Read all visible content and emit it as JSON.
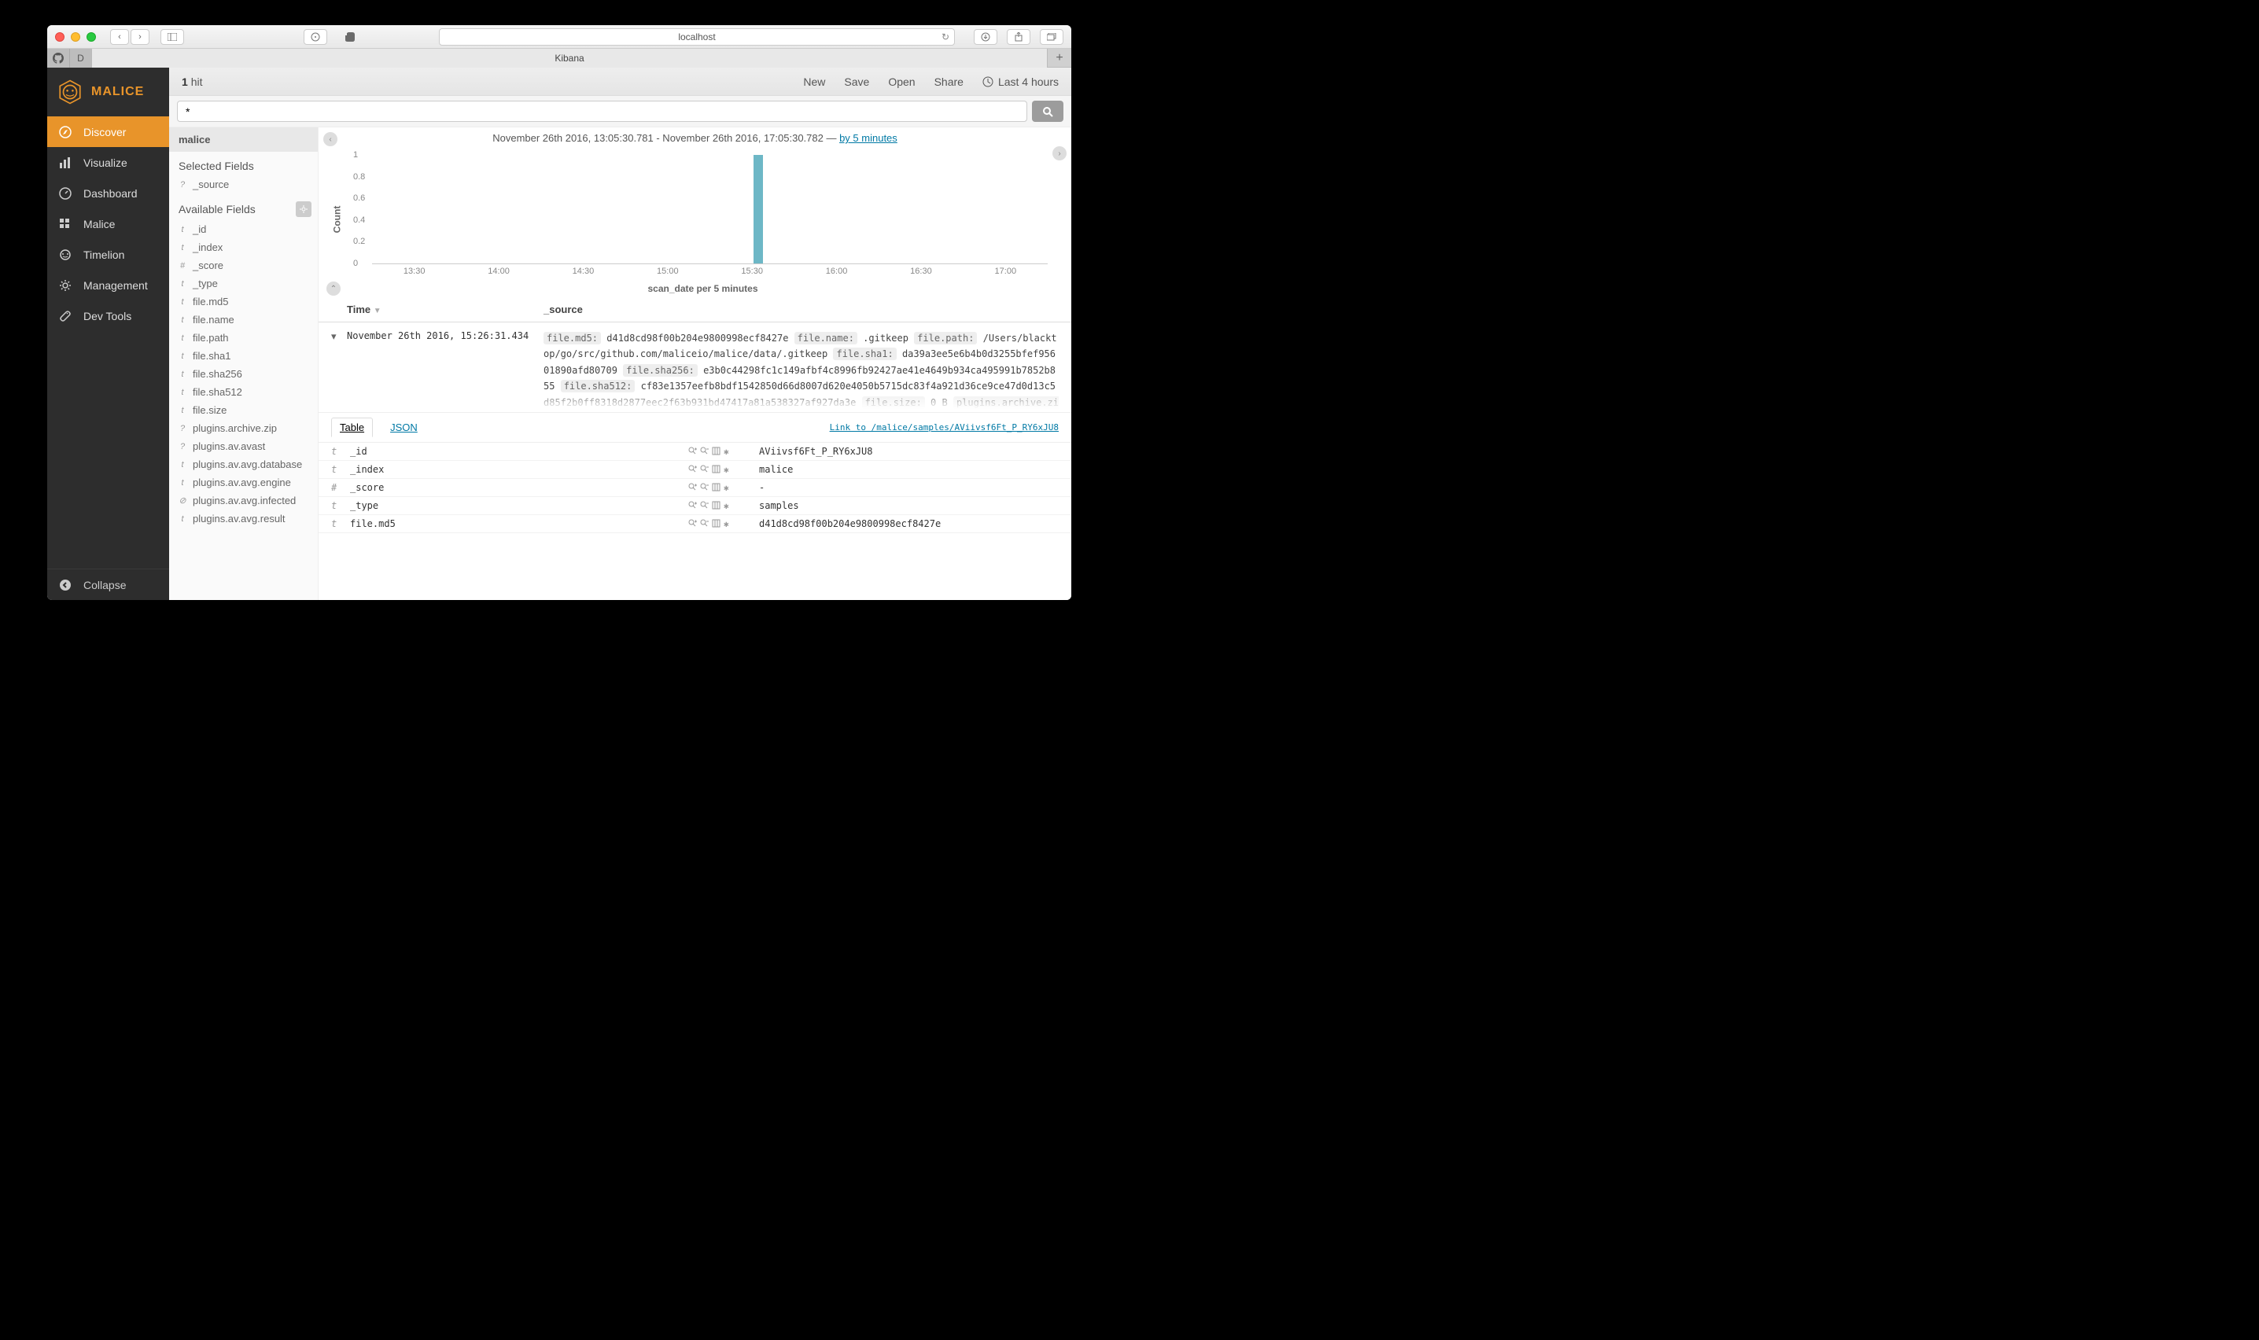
{
  "browser": {
    "address": "localhost",
    "tab_title": "Kibana"
  },
  "app_name": "MALICE",
  "sidebar": {
    "items": [
      {
        "label": "Discover"
      },
      {
        "label": "Visualize"
      },
      {
        "label": "Dashboard"
      },
      {
        "label": "Malice"
      },
      {
        "label": "Timelion"
      },
      {
        "label": "Management"
      },
      {
        "label": "Dev Tools"
      }
    ],
    "collapse": "Collapse"
  },
  "topbar": {
    "hits_count": "1",
    "hits_label": "hit",
    "new": "New",
    "save": "Save",
    "open": "Open",
    "share": "Share",
    "time_range": "Last 4 hours"
  },
  "search": {
    "query": "*"
  },
  "index_pattern": "malice",
  "fields": {
    "selected_header": "Selected Fields",
    "selected": [
      {
        "t": "?",
        "n": "_source"
      }
    ],
    "available_header": "Available Fields",
    "available": [
      {
        "t": "t",
        "n": "_id"
      },
      {
        "t": "t",
        "n": "_index"
      },
      {
        "t": "#",
        "n": "_score"
      },
      {
        "t": "t",
        "n": "_type"
      },
      {
        "t": "t",
        "n": "file.md5"
      },
      {
        "t": "t",
        "n": "file.name"
      },
      {
        "t": "t",
        "n": "file.path"
      },
      {
        "t": "t",
        "n": "file.sha1"
      },
      {
        "t": "t",
        "n": "file.sha256"
      },
      {
        "t": "t",
        "n": "file.sha512"
      },
      {
        "t": "t",
        "n": "file.size"
      },
      {
        "t": "?",
        "n": "plugins.archive.zip"
      },
      {
        "t": "?",
        "n": "plugins.av.avast"
      },
      {
        "t": "t",
        "n": "plugins.av.avg.database"
      },
      {
        "t": "t",
        "n": "plugins.av.avg.engine"
      },
      {
        "t": "⊘",
        "n": "plugins.av.avg.infected"
      },
      {
        "t": "t",
        "n": "plugins.av.avg.result"
      }
    ]
  },
  "timerange": {
    "text_prefix": "November 26th 2016, 13:05:30.781 - November 26th 2016, 17:05:30.782 — ",
    "link": "by 5 minutes"
  },
  "chart_data": {
    "type": "bar",
    "ylabel": "Count",
    "xlabel": "scan_date per 5 minutes",
    "ylim": [
      0,
      1
    ],
    "y_ticks": [
      0,
      0.2,
      0.4,
      0.6,
      0.8,
      1
    ],
    "x_ticks": [
      "13:30",
      "14:00",
      "14:30",
      "15:00",
      "15:30",
      "16:00",
      "16:30",
      "17:00"
    ],
    "bars": [
      {
        "x_fraction": 0.565,
        "value": 1
      }
    ]
  },
  "doc_table": {
    "headers": {
      "time": "Time",
      "source": "_source"
    },
    "row": {
      "time": "November 26th 2016, 15:26:31.434",
      "source_kv": [
        {
          "k": "file.md5:",
          "v": "d41d8cd98f00b204e9800998ecf8427e"
        },
        {
          "k": "file.name:",
          "v": ".gitkeep"
        },
        {
          "k": "file.path:",
          "v": "/Users/blacktop/go/src/github.com/maliceio/malice/data/.gitkeep"
        },
        {
          "k": "file.sha1:",
          "v": "da39a3ee5e6b4b0d3255bfef95601890afd80709"
        },
        {
          "k": "file.sha256:",
          "v": "e3b0c44298fc1c149afbf4c8996fb92427ae41e4649b934ca495991b7852b855"
        },
        {
          "k": "file.sha512:",
          "v": "cf83e1357eefb8bdf1542850d66d8007d620e4050b5715dc83f4a921d36ce9ce47d0d13c5d85f2b0ff8318d2877eec2f63b931bd47417a81a538327af927da3e"
        },
        {
          "k": "file.size:",
          "v": "0 B"
        },
        {
          "k": "plugins.archive.zip:",
          "v": ""
        }
      ]
    },
    "tabs": {
      "table": "Table",
      "json": "JSON"
    },
    "detail_link": "Link to /malice/samples/AViivsf6Ft_P_RY6xJU8",
    "details": [
      {
        "t": "t",
        "n": "_id",
        "v": "AViivsf6Ft_P_RY6xJU8"
      },
      {
        "t": "t",
        "n": "_index",
        "v": "malice"
      },
      {
        "t": "#",
        "n": "_score",
        "v": " - "
      },
      {
        "t": "t",
        "n": "_type",
        "v": "samples"
      },
      {
        "t": "t",
        "n": "file.md5",
        "v": "d41d8cd98f00b204e9800998ecf8427e"
      }
    ]
  }
}
